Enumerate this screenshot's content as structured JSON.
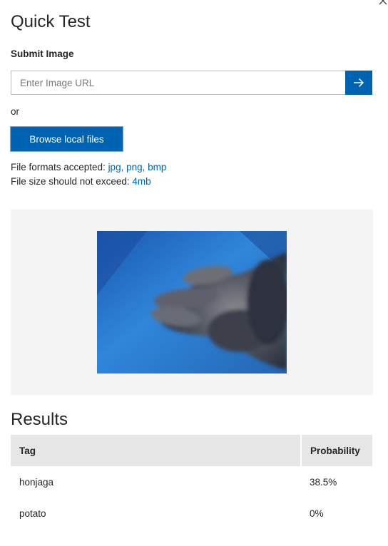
{
  "close": {
    "glyph": "×",
    "icon": "close-icon"
  },
  "title": "Quick Test",
  "submit_section": {
    "label": "Submit Image",
    "url_placeholder": "Enter Image URL",
    "url_value": "",
    "submit_icon": "arrow-right-icon",
    "or_text": "or",
    "browse_label": "Browse local files"
  },
  "info": {
    "formats_prefix": "File formats accepted: ",
    "formats": "jpg, png, bmp",
    "size_prefix": "File size should not exceed: ",
    "size": "4mb"
  },
  "preview": {
    "image_description": "photo of a hand on a blue surface"
  },
  "results": {
    "title": "Results",
    "columns": [
      "Tag",
      "Probability"
    ],
    "rows": [
      {
        "tag": "honjaga",
        "probability": "38.5%"
      },
      {
        "tag": "potato",
        "probability": "0%"
      }
    ]
  },
  "colors": {
    "accent": "#0063b1",
    "link": "#0063b1",
    "header_bg": "#e6e6e6",
    "preview_bg": "#f4f4f4"
  }
}
